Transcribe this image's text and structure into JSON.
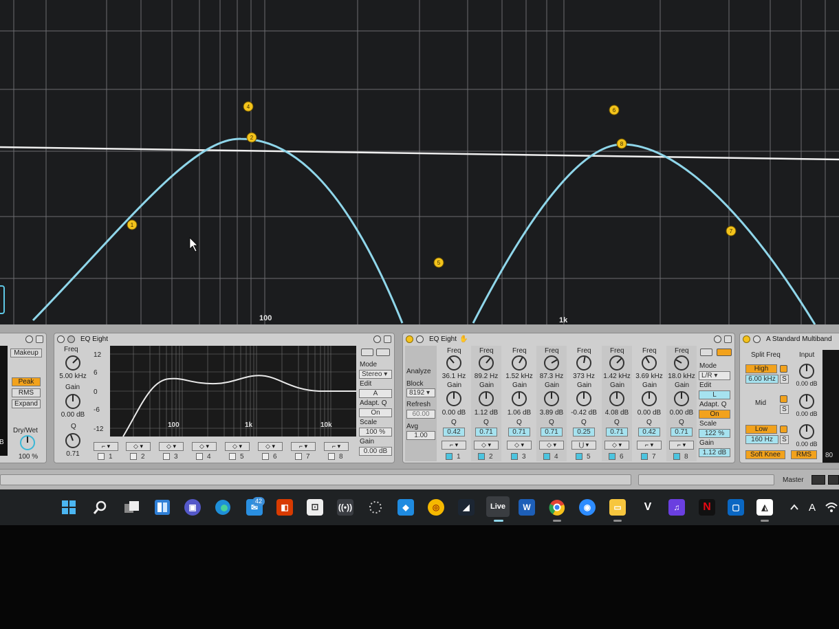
{
  "big_eq": {
    "freq_labels": [
      "100",
      "1k"
    ],
    "band_handles": [
      "1",
      "2",
      "4",
      "5",
      "6",
      "8",
      "7"
    ]
  },
  "left_device": {
    "makeup_label": "Makeup",
    "peak_label": "Peak",
    "rms_label": "RMS",
    "expand_label": "Expand",
    "drywet_label": "Dry/Wet",
    "drywet_value": "100 %",
    "b_label": "B"
  },
  "eq1": {
    "title": "EQ Eight",
    "freq_label": "Freq",
    "freq_value": "5.00 kHz",
    "gain_label": "Gain",
    "gain_value": "0.00 dB",
    "q_label": "Q",
    "q_value": "0.71",
    "db_ticks": [
      "12",
      "6",
      "0",
      "-6",
      "-12"
    ],
    "freq_ticks": [
      "100",
      "1k",
      "10k"
    ],
    "mode_label": "Mode",
    "mode_value": "Stereo",
    "edit_label": "Edit",
    "edit_value": "A",
    "adaptq_label": "Adapt. Q",
    "adaptq_value": "On",
    "scale_label": "Scale",
    "scale_value": "100 %",
    "outgain_label": "Gain",
    "outgain_value": "0.00 dB",
    "band_numbers": [
      "1",
      "2",
      "3",
      "4",
      "5",
      "6",
      "7",
      "8"
    ]
  },
  "eq2": {
    "title": "EQ Eight",
    "analyze_label": "Analyze",
    "block_label": "Block",
    "block_value": "8192",
    "refresh_label": "Refresh",
    "refresh_value": "60.00",
    "avg_label": "Avg",
    "avg_value": "1.00",
    "bands": [
      {
        "num": "1",
        "freq": "36.1 Hz",
        "gain": "0.00 dB",
        "q": "0.42"
      },
      {
        "num": "2",
        "freq": "89.2 Hz",
        "gain": "1.12 dB",
        "q": "0.71"
      },
      {
        "num": "3",
        "freq": "1.52 kHz",
        "gain": "1.06 dB",
        "q": "0.71"
      },
      {
        "num": "4",
        "freq": "87.3 Hz",
        "gain": "3.89 dB",
        "q": "0.71"
      },
      {
        "num": "5",
        "freq": "373 Hz",
        "gain": "-0.42 dB",
        "q": "0.25"
      },
      {
        "num": "6",
        "freq": "1.42 kHz",
        "gain": "4.08 dB",
        "q": "0.71"
      },
      {
        "num": "7",
        "freq": "3.69 kHz",
        "gain": "0.00 dB",
        "q": "0.42"
      },
      {
        "num": "8",
        "freq": "18.0 kHz",
        "gain": "0.00 dB",
        "q": "0.71"
      }
    ],
    "freq_label": "Freq",
    "gain_label": "Gain",
    "q_label": "Q",
    "mode_label": "Mode",
    "mode_value": "L/R",
    "edit_label": "Edit",
    "edit_value": "L",
    "adaptq_label": "Adapt. Q",
    "adaptq_value": "On",
    "scale_label": "Scale",
    "scale_value": "122 %",
    "outgain_label": "Gain",
    "outgain_value": "1.12 dB"
  },
  "multiband": {
    "title": "A Standard Multiband",
    "split_label": "Split Freq",
    "input_label": "Input",
    "high_label": "High",
    "high_value": "6.00 kHz",
    "s_label": "S",
    "mid_label": "Mid",
    "low_label": "Low",
    "low_value": "160 Hz",
    "input_values": [
      "0.00 dB",
      "0.00 dB",
      "0.00 dB"
    ],
    "softknee_label": "Soft Knee",
    "rms_label": "RMS",
    "meter_value": "80"
  },
  "status": {
    "master_label": "Master"
  },
  "taskbar": {
    "mail_badge": "42",
    "live_label": "Live",
    "word_label": "W",
    "v_label": "V",
    "netflix_label": "N",
    "lang_label": "A"
  },
  "colors": {
    "curve": "#8fd6ea",
    "handle": "#f3c31b",
    "accent_orange": "#f2a21c",
    "accent_blue": "#a6e2ef"
  }
}
